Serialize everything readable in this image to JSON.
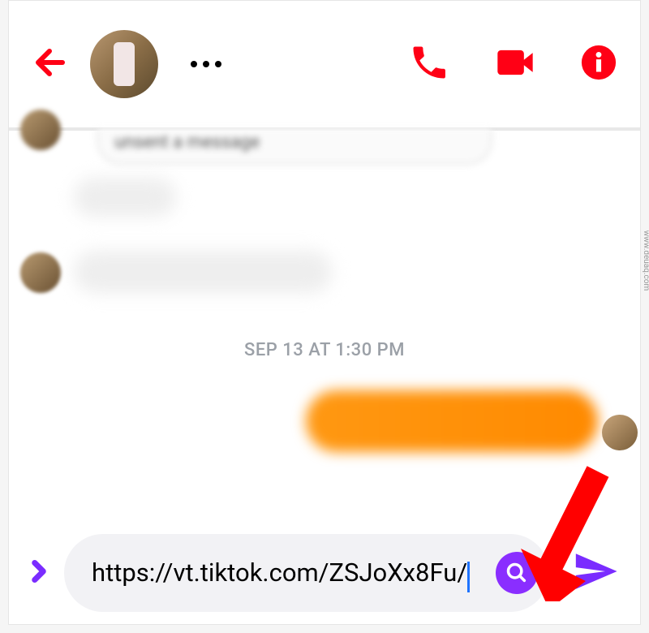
{
  "header": {
    "back_icon": "back-arrow",
    "more_icon": "more-dots",
    "actions": {
      "call": "phone-icon",
      "video": "video-icon",
      "info": "info-icon"
    }
  },
  "chat": {
    "timestamp": "SEP 13 AT 1:30 PM",
    "partial_system_message": "unsent a message",
    "incoming_messages_blurred": true,
    "outgoing_messages_blurred": true
  },
  "input": {
    "expand_icon": "chevron-right",
    "value": "https://vt.tiktok.com/ZSJoXx8Fu/",
    "search_icon": "magnifier",
    "send_icon": "send-plane"
  },
  "colors": {
    "accent_red": "#ff0015",
    "accent_purple": "#7a2cff",
    "search_purple": "#8a2eff",
    "orange_bubble": "#ff8a00",
    "timestamp": "#9ba0a7"
  },
  "annotation": {
    "type": "arrow",
    "color": "#ff0000",
    "points_to": "send-button"
  },
  "watermark": "www.deuaq.com"
}
